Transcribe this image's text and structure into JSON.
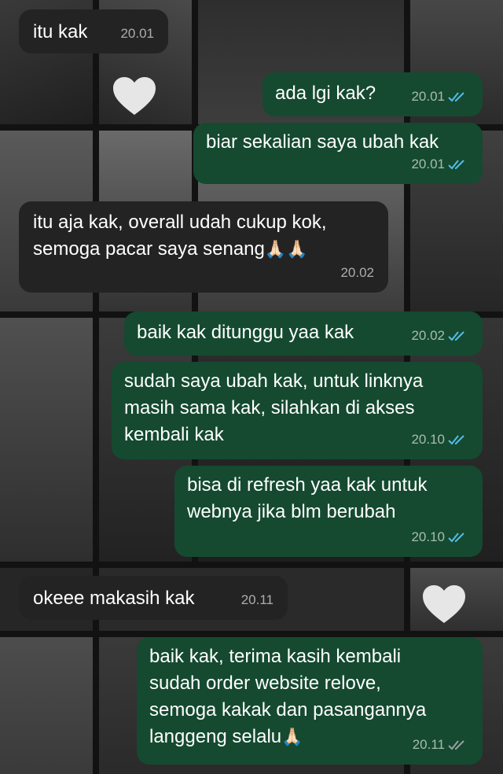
{
  "messages": [
    {
      "direction": "incoming",
      "text": "itu kak",
      "time": "20.01"
    },
    {
      "direction": "outgoing",
      "text": "ada lgi kak?",
      "time": "20.01",
      "status_icon": "double-check-read-icon"
    },
    {
      "direction": "outgoing",
      "text": "biar sekalian saya ubah kak",
      "time": "20.01",
      "status_icon": "double-check-read-icon"
    },
    {
      "direction": "incoming",
      "line1": "itu aja kak, overall udah cukup kok,",
      "line2": "semoga pacar saya senang",
      "emoji": "🙏🏻🙏🏻",
      "time": "20.02"
    },
    {
      "direction": "outgoing",
      "text": "baik kak ditunggu yaa kak",
      "time": "20.02",
      "status_icon": "double-check-read-icon"
    },
    {
      "direction": "outgoing",
      "line1": "sudah saya ubah kak, untuk linknya",
      "line2": "masih sama kak, silahkan di akses",
      "line3": "kembali kak",
      "time": "20.10",
      "status_icon": "double-check-read-icon"
    },
    {
      "direction": "outgoing",
      "line1": "bisa di refresh yaa kak untuk",
      "line2": "webnya jika blm berubah",
      "time": "20.10",
      "status_icon": "double-check-read-icon"
    },
    {
      "direction": "incoming",
      "text": "okeee makasih kak",
      "time": "20.11"
    },
    {
      "direction": "outgoing",
      "line1": "baik kak, terima kasih kembali",
      "line2": "sudah order website relove,",
      "line3": "semoga kakak dan pasangannya",
      "line4": "langgeng selalu",
      "emoji": "🙏🏻",
      "time": "20.11",
      "status_icon": "double-check-delivered-icon"
    }
  ],
  "colors": {
    "incoming_bubble": "#232323",
    "outgoing_bubble": "#154a30",
    "read_tick": "#53bdeb",
    "delivered_tick": "#9aa0a6"
  },
  "wallpaper": {
    "decor_icons": [
      "heart-icon",
      "heart-icon"
    ]
  }
}
